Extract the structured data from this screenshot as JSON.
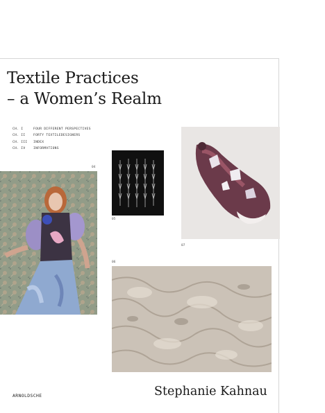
{
  "book": {
    "title_line1": "Textile Practices",
    "title_line2": "– a Women’s Realm",
    "author": "Stephanie Kahnau",
    "publisher": "ARNOLDSCHE"
  },
  "toc": [
    {
      "num": "CH. I",
      "label": "FOUR DIFFERENT PERSPECTIVES"
    },
    {
      "num": "CH. II",
      "label": "FORTY TEXTILEDESIGNERS"
    },
    {
      "num": "CH. III",
      "label": "INDEX"
    },
    {
      "num": "CH. IV",
      "label": "INFORMATIONS"
    }
  ],
  "plates": {
    "p04": "04",
    "p05": "05",
    "p06": "06",
    "p07": "07"
  }
}
